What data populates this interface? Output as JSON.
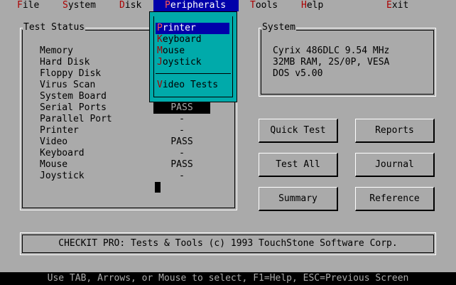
{
  "menu": {
    "file": {
      "hot": "F",
      "rest": "ile"
    },
    "system": {
      "hot": "S",
      "rest": "ystem"
    },
    "disk": {
      "hot": "D",
      "rest": "isk"
    },
    "peripherals": {
      "hot": "P",
      "rest": "eripherals"
    },
    "tools": {
      "hot": "T",
      "rest": "ools"
    },
    "help": {
      "hot": "H",
      "rest": "elp"
    },
    "exit": {
      "hot": "E",
      "rest": "xit"
    }
  },
  "dropdown": {
    "items": [
      {
        "hot": "P",
        "rest": "rinter"
      },
      {
        "hot": "K",
        "rest": "eyboard"
      },
      {
        "hot": "M",
        "rest": "ouse"
      },
      {
        "hot": "J",
        "rest": "oystick"
      },
      {
        "hot": "V",
        "rest": "ideo Tests"
      }
    ]
  },
  "test_status": {
    "title": "Test Status",
    "rows": [
      {
        "label": "Memory",
        "value": ""
      },
      {
        "label": "Hard Disk",
        "value": ""
      },
      {
        "label": "Floppy Disk",
        "value": ""
      },
      {
        "label": "Virus Scan",
        "value": ""
      },
      {
        "label": "System Board",
        "value": ""
      },
      {
        "label": "Serial Ports",
        "value": "PASS"
      },
      {
        "label": "Parallel Port",
        "value": "-"
      },
      {
        "label": "Printer",
        "value": "-"
      },
      {
        "label": "Video",
        "value": "PASS"
      },
      {
        "label": "Keyboard",
        "value": "-"
      },
      {
        "label": "Mouse",
        "value": "PASS"
      },
      {
        "label": "Joystick",
        "value": "-"
      }
    ]
  },
  "system": {
    "title": "System",
    "lines": [
      "Cyrix 486DLC 9.54 MHz",
      "32MB RAM, 2S/0P, VESA",
      "DOS v5.00"
    ]
  },
  "buttons": {
    "quick_test": "Quick Test",
    "reports": "Reports",
    "test_all": "Test All",
    "journal": "Journal",
    "summary": "Summary",
    "reference": "Reference"
  },
  "footer": "CHECKIT PRO: Tests & Tools (c) 1993 TouchStone Software Corp.",
  "statusbar": "Use TAB, Arrows, or Mouse to select, F1=Help, ESC=Previous Screen",
  "colors": {
    "background": "#aaaaaa",
    "menu_active": "#0000aa",
    "hotkey": "#aa0000",
    "dropdown": "#00aaaa"
  }
}
